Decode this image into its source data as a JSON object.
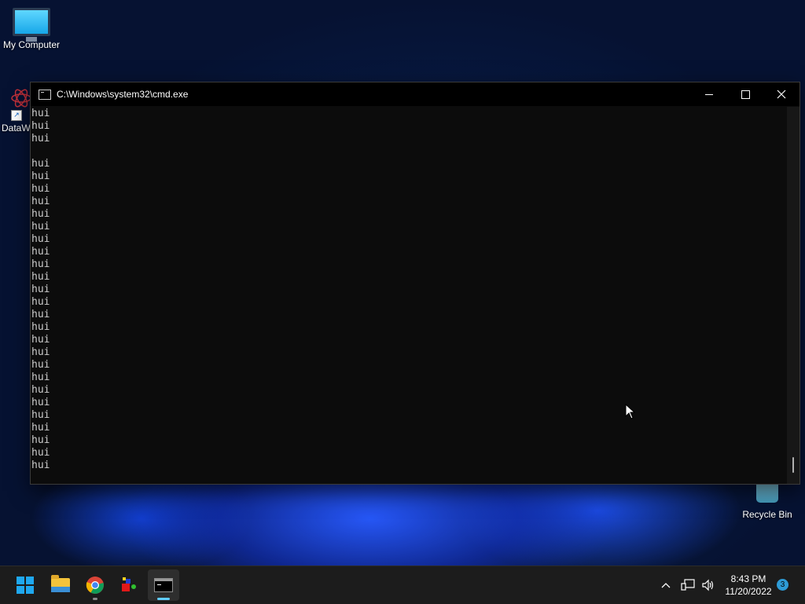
{
  "desktop": {
    "icons": [
      {
        "label": "My Computer",
        "icon": "computer-icon"
      },
      {
        "label": "DataW",
        "icon": "datawave-icon"
      },
      {
        "label": "Recycle Bin",
        "icon": "recycle-bin-icon"
      }
    ]
  },
  "window": {
    "title": "C:\\Windows\\system32\\cmd.exe",
    "icon": "cmd-icon",
    "controls": {
      "minimize": "minimize-icon",
      "maximize": "maximize-icon",
      "close": "close-icon"
    }
  },
  "console": {
    "lines": [
      "hui",
      "hui",
      "hui",
      "",
      "hui",
      "hui",
      "hui",
      "hui",
      "hui",
      "hui",
      "hui",
      "hui",
      "hui",
      "hui",
      "hui",
      "hui",
      "hui",
      "hui",
      "hui",
      "hui",
      "hui",
      "hui",
      "hui",
      "hui",
      "hui",
      "hui",
      "hui",
      "hui",
      "hui"
    ],
    "text_color": "#cccccc",
    "background": "#0c0c0c"
  },
  "taskbar": {
    "apps": [
      {
        "name": "Start",
        "icon": "windows-start-icon"
      },
      {
        "name": "File Explorer",
        "icon": "folder-icon"
      },
      {
        "name": "Google Chrome",
        "icon": "chrome-icon"
      },
      {
        "name": "Game",
        "icon": "game-app-icon"
      },
      {
        "name": "Command Prompt",
        "icon": "cmd-icon",
        "active": true
      }
    ],
    "tray": {
      "icons": [
        "chevron-up-icon",
        "network-icon",
        "volume-icon"
      ],
      "time": "8:43 PM",
      "date": "11/20/2022",
      "notifications": "3"
    }
  },
  "colors": {
    "accent": "#60cdff",
    "taskbar_bg": "#1c1c1c",
    "start_blue": "#1fa8f0"
  }
}
